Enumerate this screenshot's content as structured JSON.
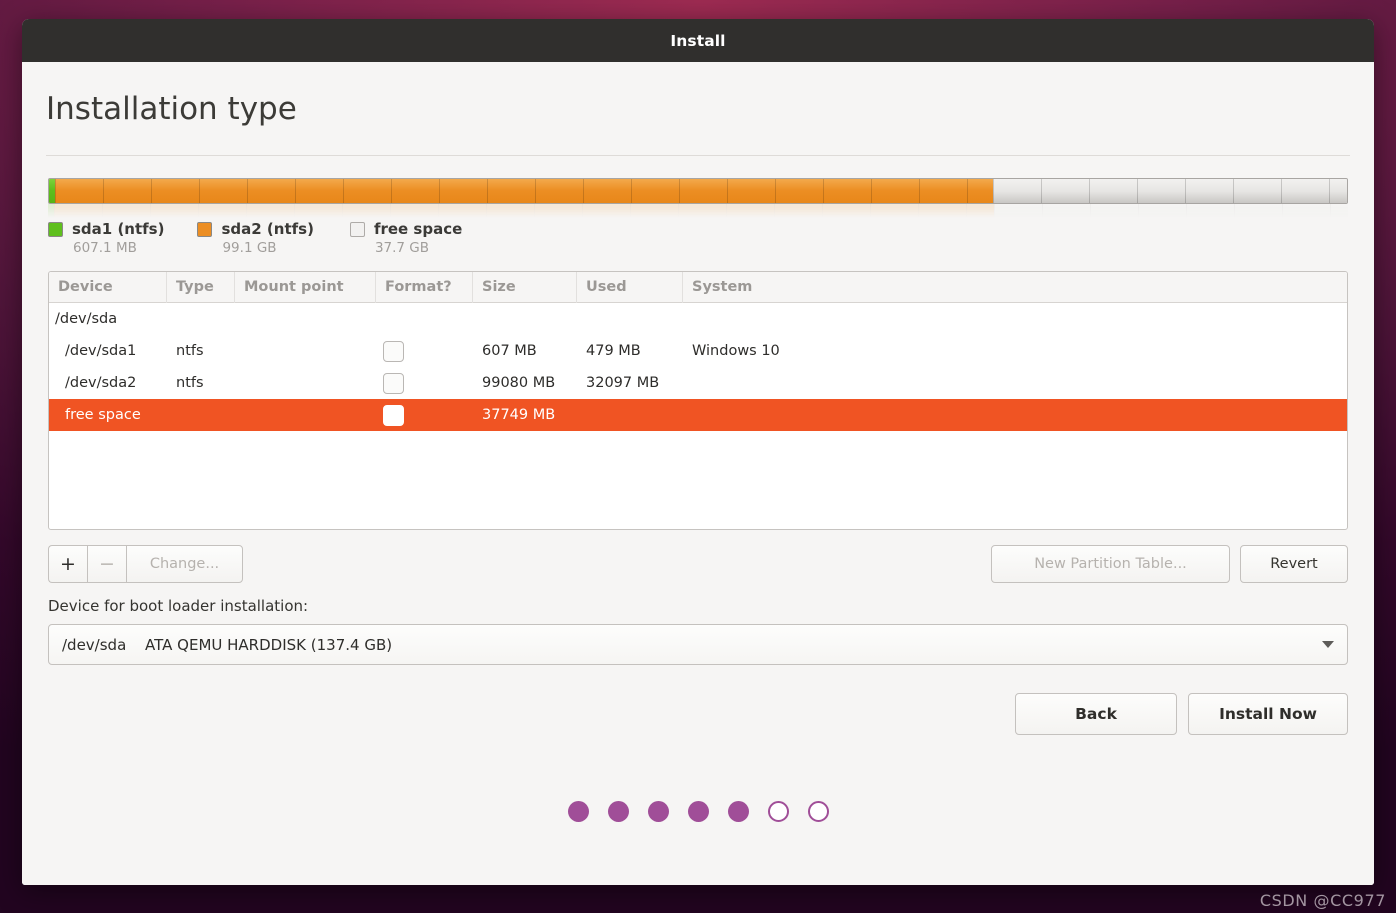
{
  "window": {
    "title": "Install"
  },
  "page": {
    "title": "Installation type"
  },
  "partition_bar": {
    "segments": [
      {
        "name": "sda1",
        "color": "#5fbf1d",
        "percent": 0.46
      },
      {
        "name": "sda2",
        "color": "#ec8e23",
        "percent": 72.3
      },
      {
        "name": "free space",
        "color": "#e7e6e4",
        "percent": 27.24
      }
    ]
  },
  "legend": {
    "items": [
      {
        "label": "sda1 (ntfs)",
        "size": "607.1 MB",
        "color": "#5fbf1d",
        "icon": "legend-swatch-green"
      },
      {
        "label": "sda2 (ntfs)",
        "size": "99.1 GB",
        "color": "#ec8e23",
        "icon": "legend-swatch-orange"
      },
      {
        "label": "free space",
        "size": "37.7 GB",
        "color": "#f2f1f0",
        "icon": "legend-swatch-white"
      }
    ]
  },
  "table": {
    "columns": [
      "Device",
      "Type",
      "Mount point",
      "Format?",
      "Size",
      "Used",
      "System"
    ],
    "rows": [
      {
        "device": "/dev/sda",
        "type": "",
        "mount_point": "",
        "has_checkbox": false,
        "size": "",
        "used": "",
        "system": "",
        "selected": false,
        "is_disk": true
      },
      {
        "device": "/dev/sda1",
        "type": "ntfs",
        "mount_point": "",
        "has_checkbox": true,
        "format_checked": false,
        "size": "607 MB",
        "used": "479 MB",
        "system": "Windows 10",
        "selected": false,
        "is_disk": false
      },
      {
        "device": "/dev/sda2",
        "type": "ntfs",
        "mount_point": "",
        "has_checkbox": true,
        "format_checked": false,
        "size": "99080 MB",
        "used": "32097 MB",
        "system": "",
        "selected": false,
        "is_disk": false
      },
      {
        "device": "free space",
        "type": "",
        "mount_point": "",
        "has_checkbox": true,
        "format_checked": false,
        "size": "37749 MB",
        "used": "",
        "system": "",
        "selected": true,
        "is_disk": false
      }
    ],
    "selection_color": "#f05423"
  },
  "toolbar": {
    "add_label": "+",
    "remove_label": "−",
    "change_label": "Change...",
    "new_partition_table_label": "New Partition Table...",
    "revert_label": "Revert",
    "add_enabled": true,
    "remove_enabled": false,
    "change_enabled": false,
    "new_partition_table_enabled": false,
    "revert_enabled": true
  },
  "boot_loader": {
    "label": "Device for boot loader installation:",
    "selected_device": "/dev/sda",
    "selected_description": "ATA QEMU HARDDISK (137.4 GB)",
    "caret_icon": "chevron-down-icon"
  },
  "actions": {
    "back_label": "Back",
    "install_label": "Install Now"
  },
  "progress_dots": {
    "total": 7,
    "filled": 5,
    "color": "#a04e98"
  },
  "watermark": {
    "text": "CSDN @CC977"
  }
}
